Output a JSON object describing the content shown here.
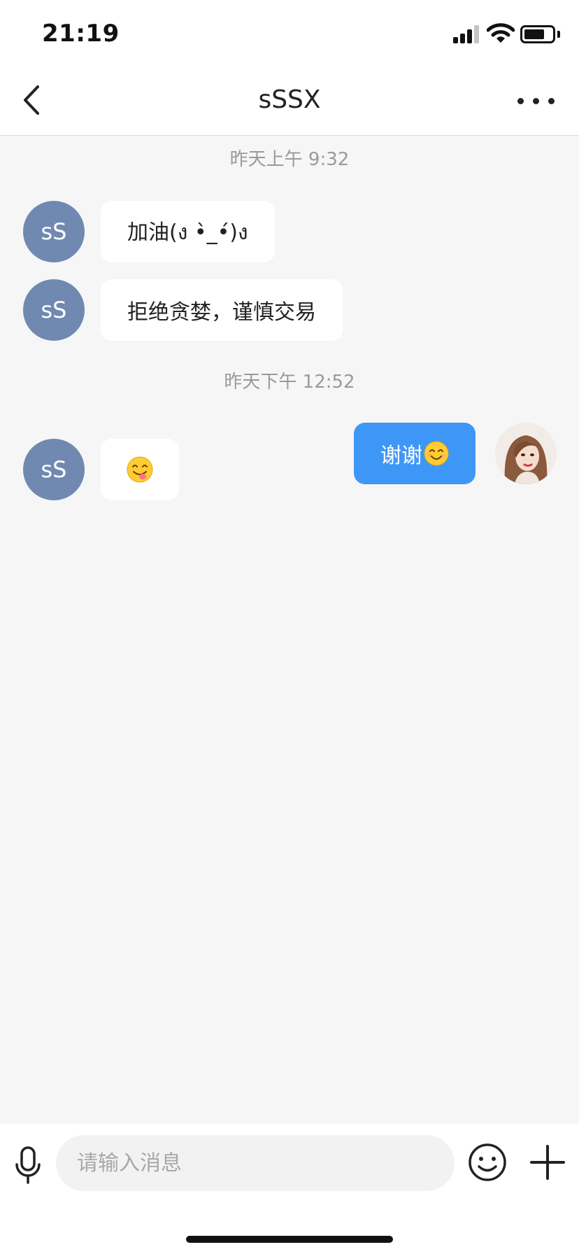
{
  "status_bar": {
    "time": "21:19"
  },
  "header": {
    "title": "sSSX"
  },
  "messages": [
    {
      "type": "timestamp",
      "text": "昨天上午 9:32"
    },
    {
      "type": "incoming",
      "avatar": "sS",
      "text": "加油(ง •̀_•́)ง"
    },
    {
      "type": "incoming",
      "avatar": "sS",
      "text": "拒绝贪婪，谨慎交易"
    },
    {
      "type": "timestamp",
      "text": "昨天下午 12:52"
    },
    {
      "type": "outgoing",
      "text": "谢谢",
      "emoji": "smiling-face-icon"
    },
    {
      "type": "incoming",
      "avatar": "sS",
      "emoji": "yum-face-icon"
    }
  ],
  "input": {
    "placeholder": "请输入消息"
  },
  "colors": {
    "outgoing_bubble": "#3e97f7",
    "avatar_bg": "#7089b1",
    "chat_bg": "#f6f6f7"
  }
}
